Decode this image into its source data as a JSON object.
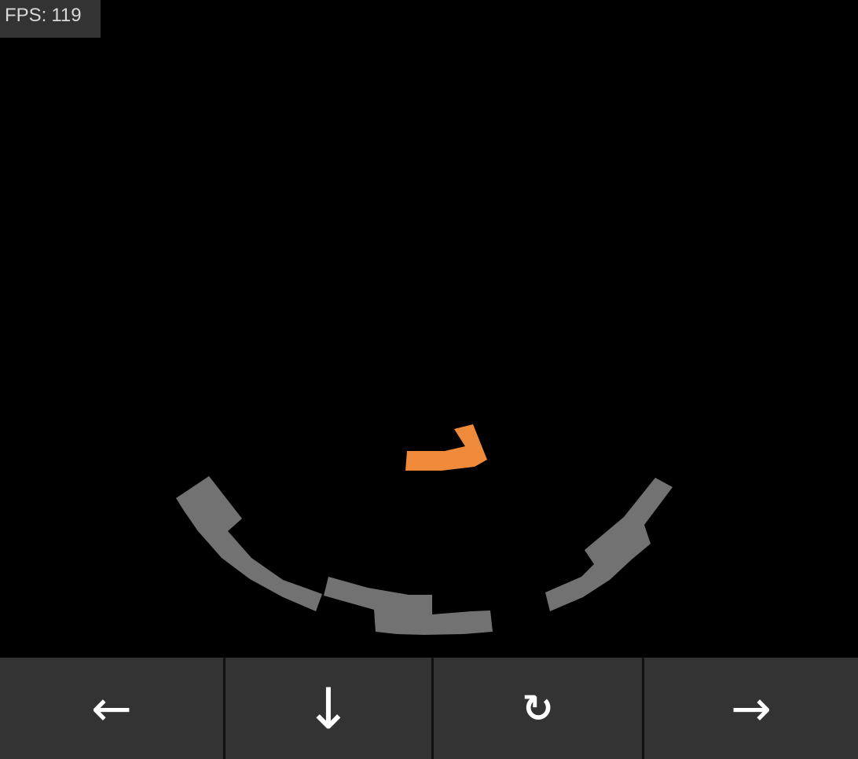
{
  "hud": {
    "fps_label": "FPS:",
    "fps_value": "119"
  },
  "colors": {
    "background": "#000000",
    "platform": "#727272",
    "active_piece": "#ef8a3a",
    "hud_bg": "#333333",
    "button_bg": "#333333",
    "button_icon": "#ffffff"
  },
  "controls": [
    {
      "name": "move-left-button",
      "icon": "arrow-left-icon",
      "glyph": "←"
    },
    {
      "name": "soft-drop-button",
      "icon": "arrow-down-icon",
      "glyph": "↓"
    },
    {
      "name": "rotate-button",
      "icon": "rotate-clockwise-icon",
      "glyph": "↻"
    },
    {
      "name": "move-right-button",
      "icon": "arrow-right-icon",
      "glyph": "→"
    }
  ]
}
